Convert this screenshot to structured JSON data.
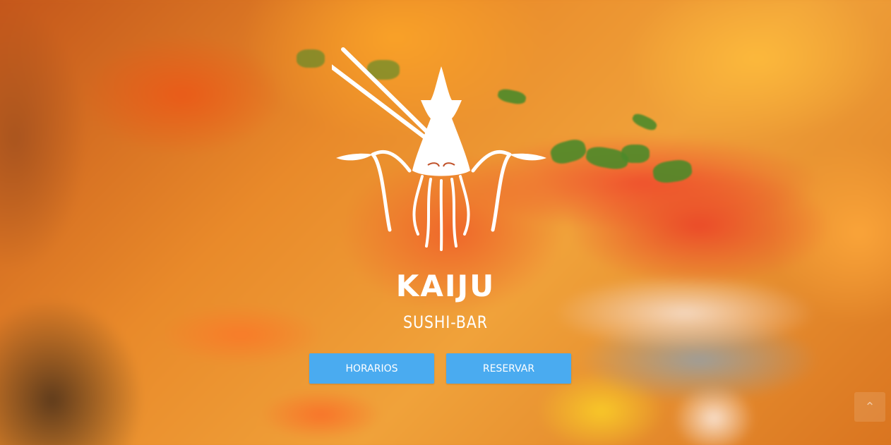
{
  "hero": {
    "brand_name": "KAIJU",
    "brand_sub": "SUSHI-BAR"
  },
  "buttons": {
    "horarios": "HORARIOS",
    "reservar": "RESERVAR"
  },
  "icons": {
    "logo": "squid-with-chopsticks-logo",
    "scroll_top": "chevron-up-icon"
  },
  "colors": {
    "button_bg": "#4aabf0",
    "text": "#ffffff"
  }
}
